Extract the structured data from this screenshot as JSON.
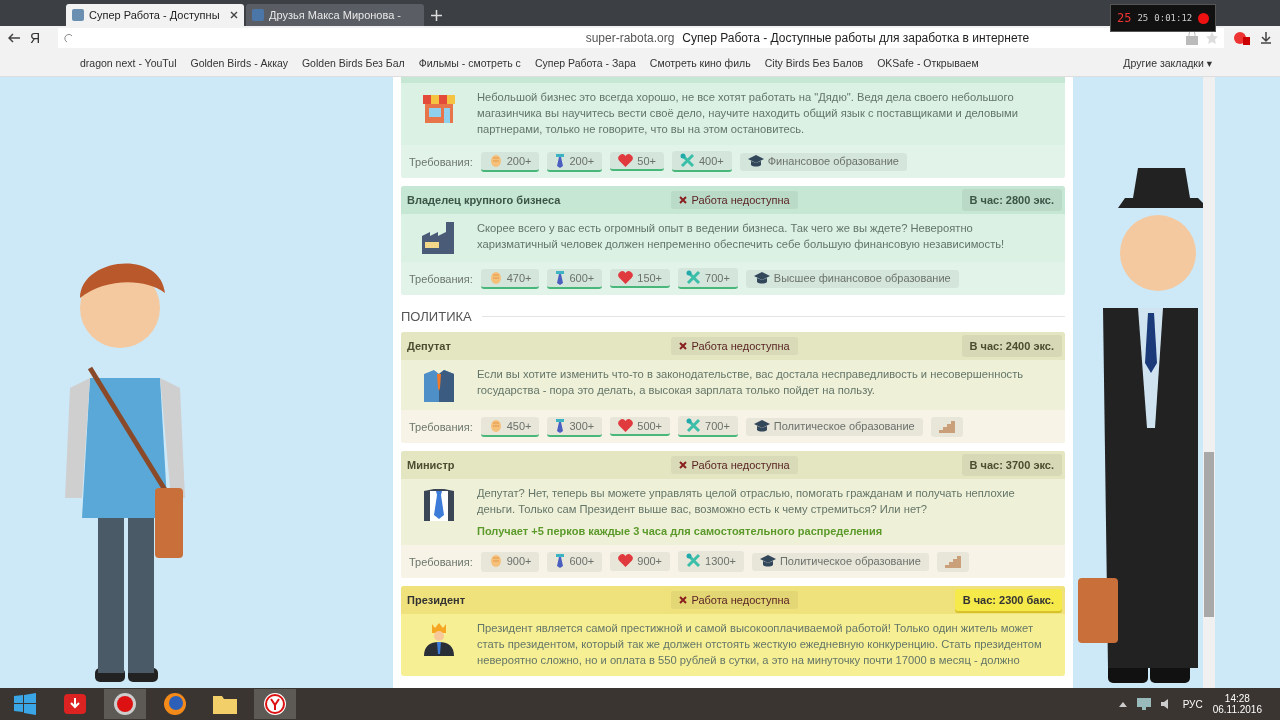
{
  "browser": {
    "tabs": [
      {
        "title": "Супер Работа - Доступны",
        "selected": true
      },
      {
        "title": "Друзья Макса Миронова -",
        "selected": false
      }
    ],
    "logo": "Я",
    "url": "super-rabota.org",
    "page_title": "Супер Работа - Доступные работы для заработка в интернете",
    "bookmarks": [
      "dragon next - YouTul",
      "Golden Birds - Аккау",
      "Golden Birds Без Бал",
      "Фильмы - смотреть с",
      "Супер Работа - Зара",
      "Смотреть кино филь",
      "City Birds Без Балов",
      "OKSafe - Открываем"
    ],
    "other_bookmarks": "Другие закладки ▾"
  },
  "recorder": {
    "fps": "25",
    "frames": "25",
    "time": "0:01:12"
  },
  "content": [
    {
      "kind": "job",
      "description": "Небольшой бизнес это всегда хорошо, не все хотят работать на \"Дядю\". Ведя дела своего небольшого магазинчика вы научитесь вести своё дело, научите находить общий язык с поставщиками и деловыми партнерами, только не говорите, что вы на этом остановитесь.",
      "requirements_label": "Требования:",
      "requirements": [
        {
          "kind": "strength",
          "value": "200+",
          "met": true
        },
        {
          "kind": "intellect",
          "value": "200+",
          "met": true
        },
        {
          "kind": "health",
          "value": "50+",
          "met": true
        },
        {
          "kind": "skill",
          "value": "400+",
          "met": true
        },
        {
          "kind": "education",
          "value": "Финансовое образование",
          "met": false
        }
      ]
    },
    {
      "kind": "job",
      "title": "Владелец крупного бизнеса",
      "status": "Работа недоступна",
      "available": false,
      "salary": "В час: 2800 экс.",
      "salary_highlighted": false,
      "description": "Скорее всего у вас есть огромный опыт в ведении бизнеса. Так чего же вы ждете? Невероятно харизматичный человек должен непременно обеспечить себе большую финансовую независимость!",
      "requirements_label": "Требования:",
      "requirements": [
        {
          "kind": "strength",
          "value": "470+",
          "met": true
        },
        {
          "kind": "intellect",
          "value": "600+",
          "met": true
        },
        {
          "kind": "health",
          "value": "150+",
          "met": true
        },
        {
          "kind": "skill",
          "value": "700+",
          "met": true
        },
        {
          "kind": "education",
          "value": "Высшее финансовое образование",
          "met": false
        }
      ]
    },
    {
      "kind": "section",
      "title": "ПОЛИТИКА"
    },
    {
      "kind": "job",
      "title": "Депутат",
      "status": "Работа недоступна",
      "available": false,
      "salary": "В час: 2400 экс.",
      "salary_highlighted": false,
      "description": "Если вы хотите изменить что-то в законодательстве, вас достала несправедливость и несовершенность государства - пора это делать, а высокая зарплата только пойдет на пользу.",
      "requirements_label": "Требования:",
      "requirements": [
        {
          "kind": "strength",
          "value": "450+",
          "met": true
        },
        {
          "kind": "intellect",
          "value": "300+",
          "met": true
        },
        {
          "kind": "health",
          "value": "500+",
          "met": true
        },
        {
          "kind": "skill",
          "value": "700+",
          "met": true
        },
        {
          "kind": "education",
          "value": "Политическое образование",
          "met": false
        },
        {
          "kind": "career",
          "met": false
        }
      ]
    },
    {
      "kind": "job",
      "title": "Министр",
      "status": "Работа недоступна",
      "available": false,
      "salary": "В час: 3700 экс.",
      "salary_highlighted": false,
      "description": "Депутат? Нет, теперь вы можете управлять целой отраслью, помогать гражданам и получать неплохие деньги. Только сам Президент выше вас, возможно есть к чему стремиться? Или нет?",
      "perk": "Получает +5 перков каждые 3 часа для самостоятельного распределения",
      "requirements_label": "Требования:",
      "requirements": [
        {
          "kind": "strength",
          "value": "900+",
          "met": false
        },
        {
          "kind": "intellect",
          "value": "600+",
          "met": false
        },
        {
          "kind": "health",
          "value": "900+",
          "met": false
        },
        {
          "kind": "skill",
          "value": "1300+",
          "met": false
        },
        {
          "kind": "education",
          "value": "Политическое образование",
          "met": false
        },
        {
          "kind": "career",
          "met": false
        }
      ]
    },
    {
      "kind": "job",
      "title": "Президент",
      "status": "Работа недоступна",
      "available": false,
      "salary": "В час: 2300 бакс.",
      "salary_highlighted": true,
      "description": "Президент является самой престижной и самой высокооплачиваемой работой! Только один житель может стать президентом, который так же должен отстоять жесткую ежедневную конкуренцию. Стать президентом невероятно сложно, но и оплата в 550 рублей в сутки, а это на минуточку почти 17000 в месяц - должно"
    }
  ],
  "taskbar": {
    "language": "РУС",
    "time": "14:28",
    "date": "06.11.2016"
  }
}
